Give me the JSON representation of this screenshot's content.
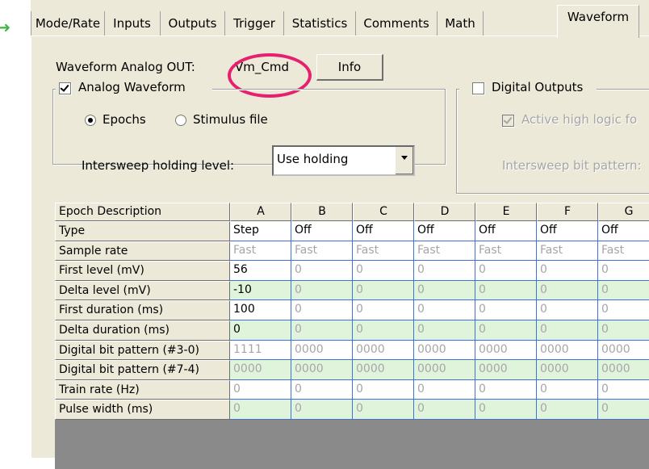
{
  "tabs": [
    {
      "label": "Mode/Rate"
    },
    {
      "label": "Inputs"
    },
    {
      "label": "Outputs"
    },
    {
      "label": "Trigger"
    },
    {
      "label": "Statistics"
    },
    {
      "label": "Comments"
    },
    {
      "label": "Math"
    },
    {
      "label": "Waveform",
      "active": true
    }
  ],
  "waveform": {
    "analog_out_label": "Waveform Analog OUT:",
    "analog_out_value": "Vm_Cmd",
    "info_button": "Info",
    "analog_group_label": "Analog Waveform",
    "analog_checked": true,
    "radio_epochs": "Epochs",
    "radio_stimulus": "Stimulus file",
    "selected_source": "Epochs",
    "holding_label": "Intersweep holding level:",
    "holding_value": "Use holding",
    "digital_group_label": "Digital Outputs",
    "digital_checked": false,
    "active_high_label": "Active high logic fo",
    "active_high_checked": true,
    "intersweep_bit_label": "Intersweep bit pattern:"
  },
  "annotation_color": "#e6206e",
  "epoch_table": {
    "corner_header": "Epoch Description",
    "columns": [
      "A",
      "B",
      "C",
      "D",
      "E",
      "F",
      "G"
    ],
    "rows": [
      {
        "label": "Type",
        "values": [
          "Step",
          "Off",
          "Off",
          "Off",
          "Off",
          "Off",
          "Off"
        ],
        "shade": "w",
        "active": [
          1,
          1,
          1,
          1,
          1,
          1,
          1
        ]
      },
      {
        "label": "Sample rate",
        "values": [
          "Fast",
          "Fast",
          "Fast",
          "Fast",
          "Fast",
          "Fast",
          "Fast"
        ],
        "shade": "w",
        "active": [
          0,
          0,
          0,
          0,
          0,
          0,
          0
        ]
      },
      {
        "label": "First level (mV)",
        "values": [
          "56",
          "0",
          "0",
          "0",
          "0",
          "0",
          "0"
        ],
        "shade": "w",
        "active": [
          1,
          0,
          0,
          0,
          0,
          0,
          0
        ]
      },
      {
        "label": "Delta level (mV)",
        "values": [
          "-10",
          "0",
          "0",
          "0",
          "0",
          "0",
          "0"
        ],
        "shade": "g",
        "active": [
          1,
          0,
          0,
          0,
          0,
          0,
          0
        ]
      },
      {
        "label": "First duration (ms)",
        "values": [
          "100",
          "0",
          "0",
          "0",
          "0",
          "0",
          "0"
        ],
        "shade": "w",
        "active": [
          1,
          0,
          0,
          0,
          0,
          0,
          0
        ]
      },
      {
        "label": "Delta duration (ms)",
        "values": [
          "0",
          "0",
          "0",
          "0",
          "0",
          "0",
          "0"
        ],
        "shade": "g",
        "active": [
          1,
          0,
          0,
          0,
          0,
          0,
          0
        ]
      },
      {
        "label": "Digital bit pattern (#3-0)",
        "values": [
          "1111",
          "0000",
          "0000",
          "0000",
          "0000",
          "0000",
          "0000"
        ],
        "shade": "w",
        "active": [
          0,
          0,
          0,
          0,
          0,
          0,
          0
        ]
      },
      {
        "label": "Digital bit pattern (#7-4)",
        "values": [
          "0000",
          "0000",
          "0000",
          "0000",
          "0000",
          "0000",
          "0000"
        ],
        "shade": "g",
        "active": [
          0,
          0,
          0,
          0,
          0,
          0,
          0
        ]
      },
      {
        "label": "Train rate (Hz)",
        "values": [
          "0",
          "0",
          "0",
          "0",
          "0",
          "0",
          "0"
        ],
        "shade": "w",
        "active": [
          0,
          0,
          0,
          0,
          0,
          0,
          0
        ]
      },
      {
        "label": "Pulse width (ms)",
        "values": [
          "0",
          "0",
          "0",
          "0",
          "0",
          "0",
          "0"
        ],
        "shade": "g",
        "active": [
          0,
          0,
          0,
          0,
          0,
          0,
          0
        ]
      }
    ]
  }
}
